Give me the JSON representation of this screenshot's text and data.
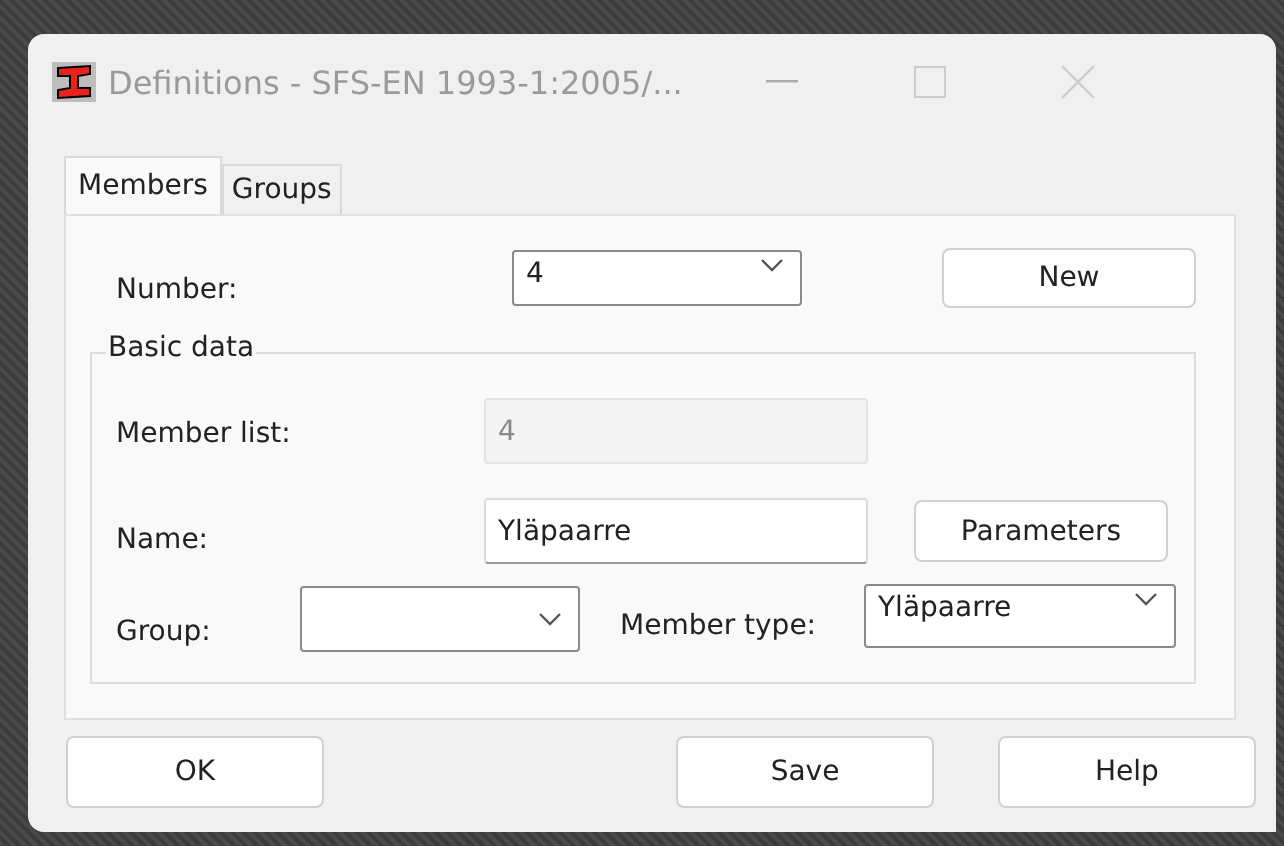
{
  "window": {
    "title": "Definitions - SFS-EN 1993-1:2005/..."
  },
  "tabs": [
    {
      "label": "Members",
      "selected": true
    },
    {
      "label": "Groups",
      "selected": false
    }
  ],
  "number": {
    "label": "Number:",
    "value": "4"
  },
  "new_button": "New",
  "basic_data": {
    "legend": "Basic data",
    "member_list": {
      "label": "Member list:",
      "value": "4",
      "disabled": true
    },
    "name": {
      "label": "Name:",
      "value": "Yläpaarre"
    },
    "parameters_button": "Parameters",
    "group": {
      "label": "Group:"
    },
    "member_type": {
      "label": "Member type:",
      "value": "Yläpaarre"
    }
  },
  "buttons": [
    "OK",
    "Save",
    "Help"
  ]
}
